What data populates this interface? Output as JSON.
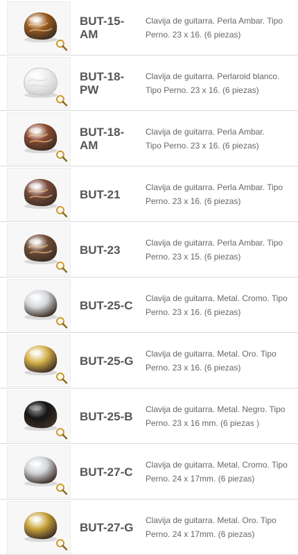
{
  "products": [
    {
      "code": "BUT-15-AM",
      "code_lines": [
        "BUT-15-",
        "AM"
      ],
      "desc_lines": [
        "Clavija de guitarra. Perla Ambar. Tipo",
        "Perno. 23 x 16. (6 piezas)"
      ],
      "finish": "amber-pearl",
      "color": "#9a5a1c"
    },
    {
      "code": "BUT-18-PW",
      "code_lines": [
        "BUT-18-",
        "PW"
      ],
      "desc_lines": [
        "Clavija de guitarra. Perlaroid blanco.",
        "Tipo Perno. 23 x 16. (6 piezas)"
      ],
      "finish": "white-pearloid",
      "color": "#efefef"
    },
    {
      "code": "BUT-18-AM",
      "code_lines": [
        "BUT-18-",
        "AM"
      ],
      "desc_lines": [
        "Clavija de guitarra. Perla Ambar.",
        "Tipo Perno. 23 x 16. (6 piezas)"
      ],
      "finish": "amber-pearl",
      "color": "#8a4a30"
    },
    {
      "code": "BUT-21",
      "code_lines": [
        "BUT-21"
      ],
      "desc_lines": [
        "Clavija de guitarra. Perla Ambar. Tipo",
        "Perno. 23 x 16. (6 piezas)"
      ],
      "finish": "amber-pearl",
      "color": "#7a4a3a"
    },
    {
      "code": "BUT-23",
      "code_lines": [
        "BUT-23"
      ],
      "desc_lines": [
        "Clavija de guitarra. Perla Ambar. Tipo",
        "Perno. 23 x 15. (6 piezas)"
      ],
      "finish": "amber-pearl",
      "color": "#6e4a34"
    },
    {
      "code": "BUT-25-C",
      "code_lines": [
        "BUT-25-C"
      ],
      "desc_lines": [
        "Clavija de guitarra. Metal. Cromo. Tipo",
        "Perno. 23 x 16. (6 piezas)"
      ],
      "finish": "chrome",
      "color": "#d4d7db"
    },
    {
      "code": "BUT-25-G",
      "code_lines": [
        "BUT-25-G"
      ],
      "desc_lines": [
        "Clavija de guitarra. Metal. Oro. Tipo",
        "Perno. 23 x 16. (6 piezas)"
      ],
      "finish": "gold",
      "color": "#d6b24a"
    },
    {
      "code": "BUT-25-B",
      "code_lines": [
        "BUT-25-B"
      ],
      "desc_lines": [
        "Clavija de guitarra. Metal. Negro. Tipo",
        "Perno. 23 x 16 mm. (6 piezas )"
      ],
      "finish": "black",
      "color": "#151515"
    },
    {
      "code": "BUT-27-C",
      "code_lines": [
        "BUT-27-C"
      ],
      "desc_lines": [
        "Clavija de guitarra. Metal. Cromo. Tipo",
        "Perno. 24 x 17mm. (6 piezas)"
      ],
      "finish": "chrome",
      "color": "#cfd2d6"
    },
    {
      "code": "BUT-27-G",
      "code_lines": [
        "BUT-27-G"
      ],
      "desc_lines": [
        "Clavija de guitarra. Metal. Oro. Tipo",
        "Perno. 24 x 17mm. (6 piezas)"
      ],
      "finish": "gold",
      "color": "#c9a43a"
    }
  ],
  "icons": {
    "zoom": "magnifier-zoom-icon",
    "peg": "guitar-tuner-button-icon"
  },
  "colors": {
    "code_text": "#555555",
    "desc_text": "#666666",
    "divider": "#d9d9d9",
    "zoom_ring": "#c8901e"
  }
}
